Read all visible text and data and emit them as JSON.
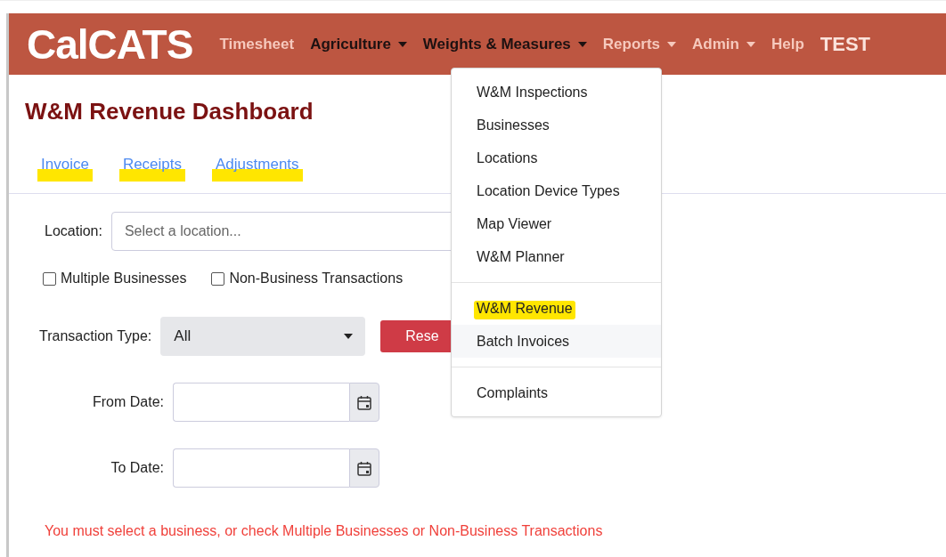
{
  "navbar": {
    "logo": "CalCATS",
    "items": [
      {
        "label": "Timesheet",
        "active": false,
        "dropdown": false
      },
      {
        "label": "Agriculture",
        "active": true,
        "dropdown": true
      },
      {
        "label": "Weights & Measures",
        "active": true,
        "dropdown": true
      },
      {
        "label": "Reports",
        "active": false,
        "dropdown": true
      },
      {
        "label": "Admin",
        "active": false,
        "dropdown": true
      },
      {
        "label": "Help",
        "active": false,
        "dropdown": false
      }
    ],
    "environment": "TEST"
  },
  "dropdown_menu": {
    "groups": [
      [
        {
          "label": "W&M Inspections",
          "highlighted": false,
          "hovered": false
        },
        {
          "label": "Businesses",
          "highlighted": false,
          "hovered": false
        },
        {
          "label": "Locations",
          "highlighted": false,
          "hovered": false
        },
        {
          "label": "Location Device Types",
          "highlighted": false,
          "hovered": false
        },
        {
          "label": "Map Viewer",
          "highlighted": false,
          "hovered": false
        },
        {
          "label": "W&M Planner",
          "highlighted": false,
          "hovered": false
        }
      ],
      [
        {
          "label": "W&M Revenue",
          "highlighted": true,
          "hovered": false
        },
        {
          "label": "Batch Invoices",
          "highlighted": false,
          "hovered": true
        }
      ],
      [
        {
          "label": "Complaints",
          "highlighted": false,
          "hovered": false
        }
      ]
    ]
  },
  "page": {
    "title": "W&M Revenue Dashboard",
    "tabs": [
      {
        "label": "Invoice",
        "highlighted": true
      },
      {
        "label": "Receipts",
        "highlighted": true
      },
      {
        "label": "Adjustments",
        "highlighted": true
      }
    ],
    "location": {
      "label": "Location:",
      "placeholder": "Select a location..."
    },
    "checkboxes": [
      {
        "label": "Multiple Businesses",
        "checked": false
      },
      {
        "label": "Non-Business Transactions",
        "checked": false
      }
    ],
    "transaction_type": {
      "label": "Transaction Type:",
      "value": "All"
    },
    "reset_button": "Rese",
    "from_date": {
      "label": "From Date:"
    },
    "to_date": {
      "label": "To Date:"
    },
    "error": "You must select a business, or check Multiple Businesses or Non-Business Transactions"
  }
}
